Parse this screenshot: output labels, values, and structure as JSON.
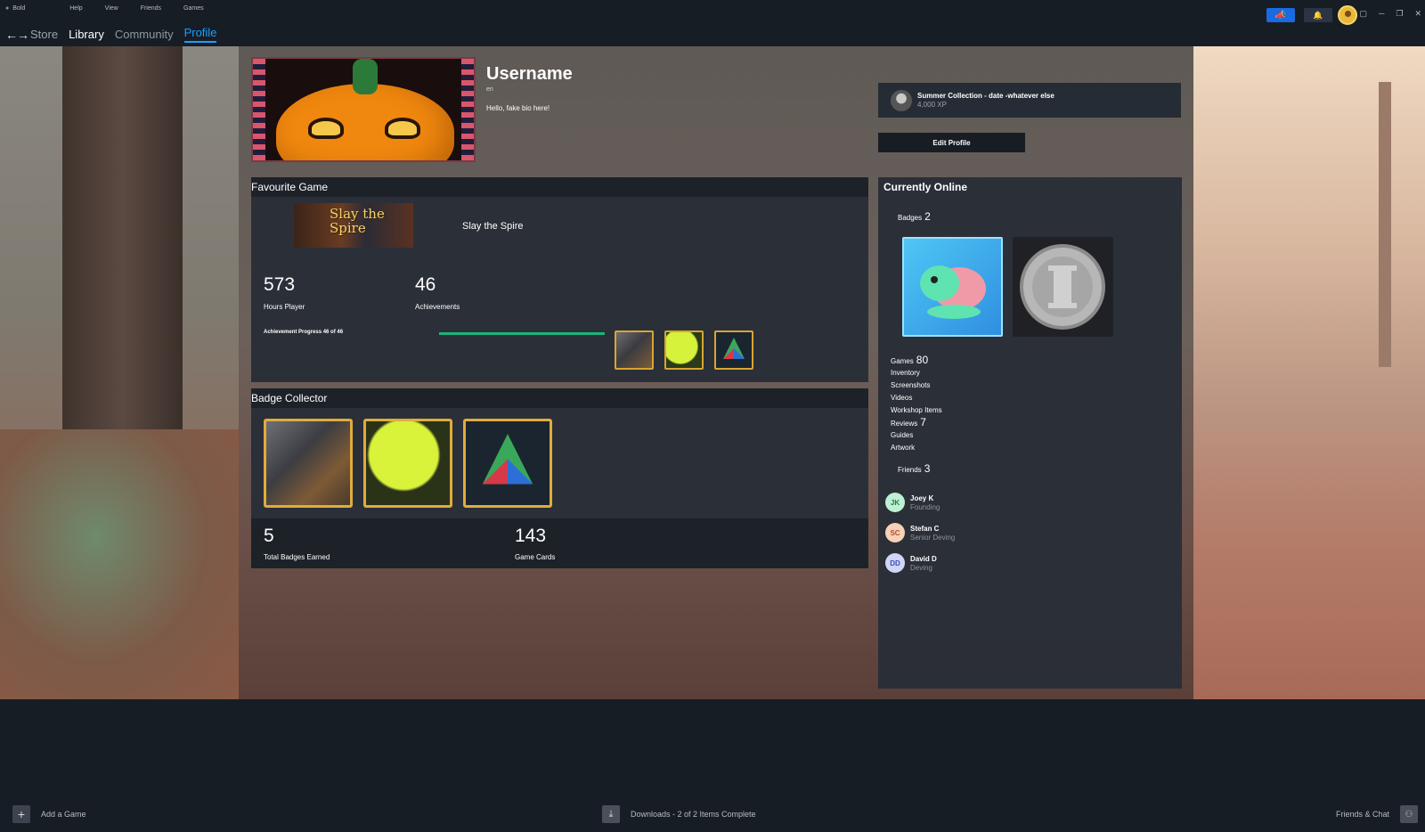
{
  "menu": {
    "items": [
      "Bold",
      "Help",
      "View",
      "Friends",
      "Games"
    ]
  },
  "nav": {
    "back_forward": "←→",
    "tabs": [
      "Store",
      "Library",
      "Community",
      "Profile"
    ],
    "active": "Profile"
  },
  "profile": {
    "username": "Username",
    "language": "en",
    "bio": "Hello, fake bio here!"
  },
  "collection": {
    "title": "Summer Collection - date -whatever else",
    "xp": "4,000 XP"
  },
  "edit_profile_label": "Edit Profile",
  "favourite": {
    "heading": "Favourite Game",
    "thumb_text": "Slay the Spire",
    "game_name": "Slay the Spire",
    "hours": "573",
    "hours_label": "Hours Player",
    "achievements": "46",
    "achievements_label": "Achievements",
    "progress_label": "Achievement Progress 46 of 46",
    "progress_fraction": 1.0,
    "achievement_icons": [
      "armor-icon",
      "slime-icon",
      "triangle-gem-icon"
    ]
  },
  "badge_collector": {
    "heading": "Badge Collector",
    "badge_icons": [
      "armor-icon",
      "slime-icon",
      "triangle-gem-icon"
    ],
    "total_badges": "5",
    "total_badges_label": "Total Badges Earned",
    "game_cards": "143",
    "game_cards_label": "Game Cards"
  },
  "online": {
    "heading": "Currently Online",
    "badges_label": "Badges",
    "badges_count": "2",
    "badge_icons": [
      "turtle-icon",
      "column-coin-icon"
    ],
    "games_label": "Games",
    "games_count": "80",
    "links": [
      "Inventory",
      "Screenshots",
      "Videos",
      "Workshop Items"
    ],
    "reviews_label": "Reviews",
    "reviews_count": "7",
    "links2": [
      "Guides",
      "Artwork"
    ],
    "friends_label": "Friends",
    "friends_count": "3",
    "friends": [
      {
        "initials": "JK",
        "name": "Joey K",
        "status": "Founding",
        "color": "#bff0d3",
        "text_color": "#1f7a4a"
      },
      {
        "initials": "SC",
        "name": "Stefan C",
        "status": "Senior Deving",
        "color": "#f7d1b8",
        "text_color": "#b2502a"
      },
      {
        "initials": "DD",
        "name": "David D",
        "status": "Deving",
        "color": "#cfd6f7",
        "text_color": "#3a4fb2"
      }
    ]
  },
  "statusbar": {
    "add_game": "Add a Game",
    "downloads": "Downloads - 2 of 2 Items Complete",
    "friends_chat": "Friends & Chat"
  },
  "colors": {
    "accent": "#1a9fff",
    "progress": "#1db37a",
    "panel": "#292e37",
    "badge_border": "#e0ac3c"
  }
}
